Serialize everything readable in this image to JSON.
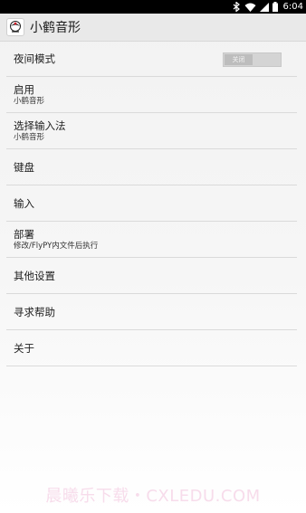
{
  "status_bar": {
    "time": "6:04",
    "icons": [
      "bluetooth-icon",
      "wifi-icon",
      "signal-icon",
      "battery-icon"
    ]
  },
  "action_bar": {
    "title": "小鹤音形",
    "icon": "crane-app-icon"
  },
  "settings": [
    {
      "title": "夜间模式",
      "summary": "",
      "toggle_label": "关闭"
    },
    {
      "title": "启用",
      "summary": "小鹤音形"
    },
    {
      "title": "选择输入法",
      "summary": "小鹤音形"
    },
    {
      "title": "键盘",
      "summary": ""
    },
    {
      "title": "输入",
      "summary": ""
    },
    {
      "title": "部署",
      "summary": "修改/FlyPY内文件后执行"
    },
    {
      "title": "其他设置",
      "summary": ""
    },
    {
      "title": "寻求帮助",
      "summary": ""
    },
    {
      "title": "关于",
      "summary": ""
    }
  ],
  "night_mode_on": false,
  "watermark": "晨曦乐下载・CXLEDU.COM",
  "colors": {
    "status_bar": "#000000",
    "action_bar": "#e9e9e9",
    "divider": "#dadada",
    "watermark": "#f7dceb"
  }
}
